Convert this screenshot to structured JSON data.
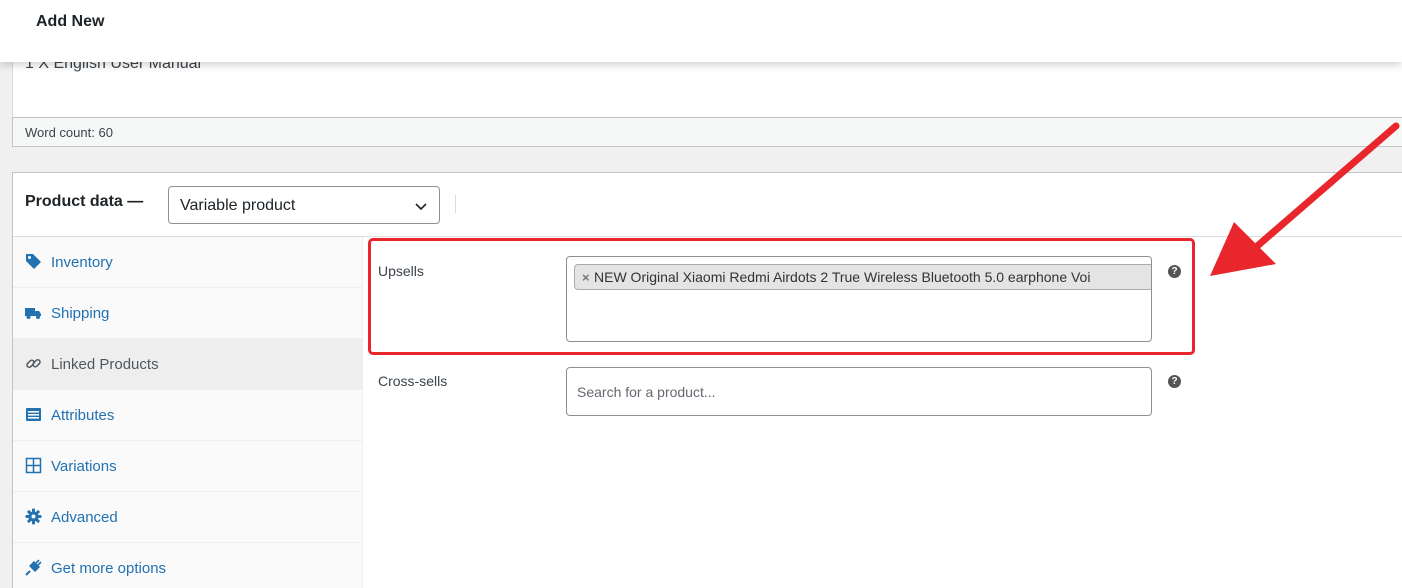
{
  "topbar": {
    "title": "Add New"
  },
  "editor": {
    "content_line": "1 X English User Manual",
    "word_count": "Word count: 60"
  },
  "product_data": {
    "label": "Product data —",
    "type_select": {
      "selected": "Variable product"
    },
    "tabs": [
      {
        "label": "Inventory",
        "icon": "tag-icon",
        "active": false
      },
      {
        "label": "Shipping",
        "icon": "truck-icon",
        "active": false
      },
      {
        "label": "Linked Products",
        "icon": "link-icon",
        "active": true
      },
      {
        "label": "Attributes",
        "icon": "list-icon",
        "active": false
      },
      {
        "label": "Variations",
        "icon": "grid-icon",
        "active": false
      },
      {
        "label": "Advanced",
        "icon": "gear-icon",
        "active": false
      },
      {
        "label": "Get more options",
        "icon": "plug-icon",
        "active": false
      }
    ],
    "linked": {
      "upsells_label": "Upsells",
      "upsells_selected": [
        {
          "remove": "×",
          "text": "NEW Original Xiaomi Redmi Airdots 2 True Wireless Bluetooth 5.0 earphone Voi"
        }
      ],
      "crosssells_label": "Cross-sells",
      "crosssells_placeholder": "Search for a product...",
      "help_glyph": "?"
    }
  },
  "colors": {
    "link": "#2271b1",
    "annotation": "#e8262b",
    "active_tab": "#eeeeee"
  }
}
